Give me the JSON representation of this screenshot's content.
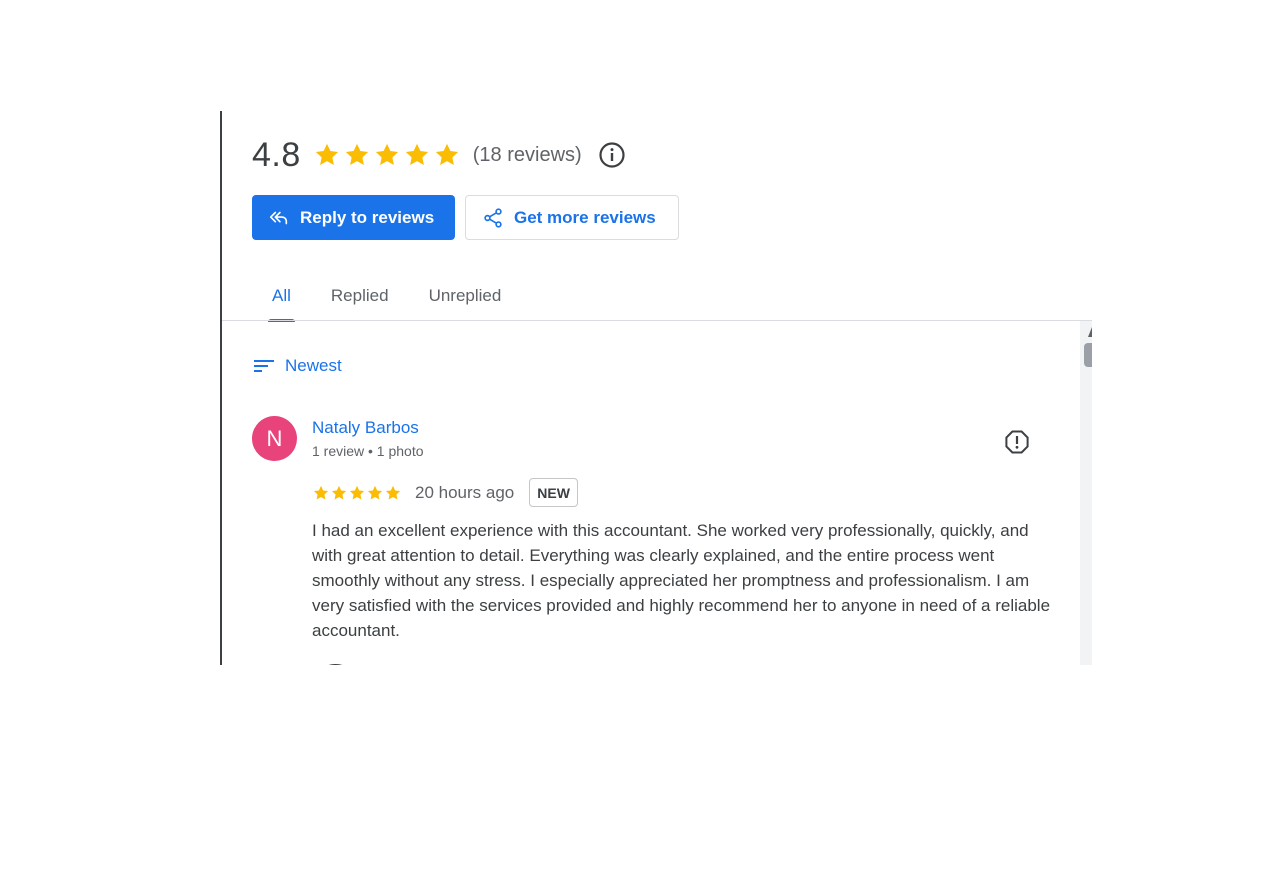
{
  "summary": {
    "rating": "4.8",
    "star_rating": 4.8,
    "review_count": "(18 reviews)",
    "star_color": "#fbbc04"
  },
  "actions": {
    "reply_label": "Reply to reviews",
    "get_more_label": "Get more reviews",
    "reply_icon": "reply-all-icon",
    "share_icon": "share-icon"
  },
  "tabs": [
    {
      "label": "All",
      "active": true
    },
    {
      "label": "Replied",
      "active": false
    },
    {
      "label": "Unreplied",
      "active": false
    }
  ],
  "sort": {
    "label": "Newest",
    "icon": "sort-icon"
  },
  "review": {
    "avatar_letter": "N",
    "avatar_color": "#e8437a",
    "name": "Nataly Barbos",
    "meta": "1 review • 1 photo",
    "stars": 5,
    "time": "20 hours ago",
    "badge": "NEW",
    "text": "I had an excellent experience with this accountant. She worked very professionally, quickly, and with great attention to detail. Everything was clearly explained, and the entire process went smoothly without any stress. I especially appreciated her promptness and professionalism. I am very satisfied with the services provided and highly recommend her to anyone in need of a reliable accountant."
  },
  "colors": {
    "accent": "#1a73e8",
    "text": "#3c4043",
    "secondary_text": "#5f6368"
  }
}
